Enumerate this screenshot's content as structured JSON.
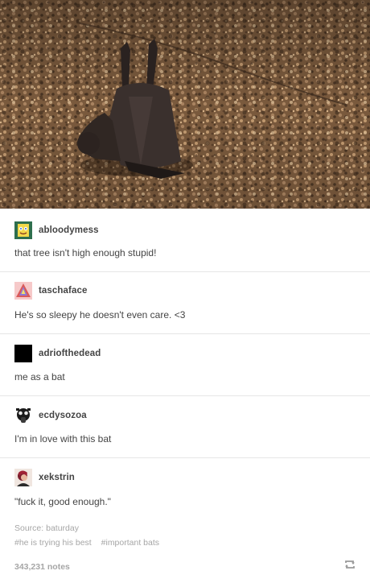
{
  "photo": {
    "subject_icon": "bat-upside-down-photo"
  },
  "posts": [
    {
      "username": "abloodymess",
      "avatar_icon": "sponge-avatar-icon",
      "comment": "that tree isn't high enough stupid!"
    },
    {
      "username": "taschaface",
      "avatar_icon": "triangle-avatar-icon",
      "comment": "He's so sleepy he doesn't even care. <3"
    },
    {
      "username": "adriofthedead",
      "avatar_icon": "black-square-avatar-icon",
      "comment": "me as a bat"
    },
    {
      "username": "ecdysozoa",
      "avatar_icon": "gasmask-avatar-icon",
      "comment": "I'm in love with this bat"
    },
    {
      "username": "xekstrin",
      "avatar_icon": "portrait-avatar-icon",
      "comment": "\"fuck it, good enough.\""
    }
  ],
  "footer": {
    "source": "Source: baturday",
    "tags": [
      "#he is trying his best",
      "#important bats"
    ],
    "notes": "343,231 notes",
    "reblog_icon": "reblog-icon"
  },
  "colors": {
    "text": "#444444",
    "muted": "#a6a6a6",
    "divider": "#e6e6e6"
  }
}
